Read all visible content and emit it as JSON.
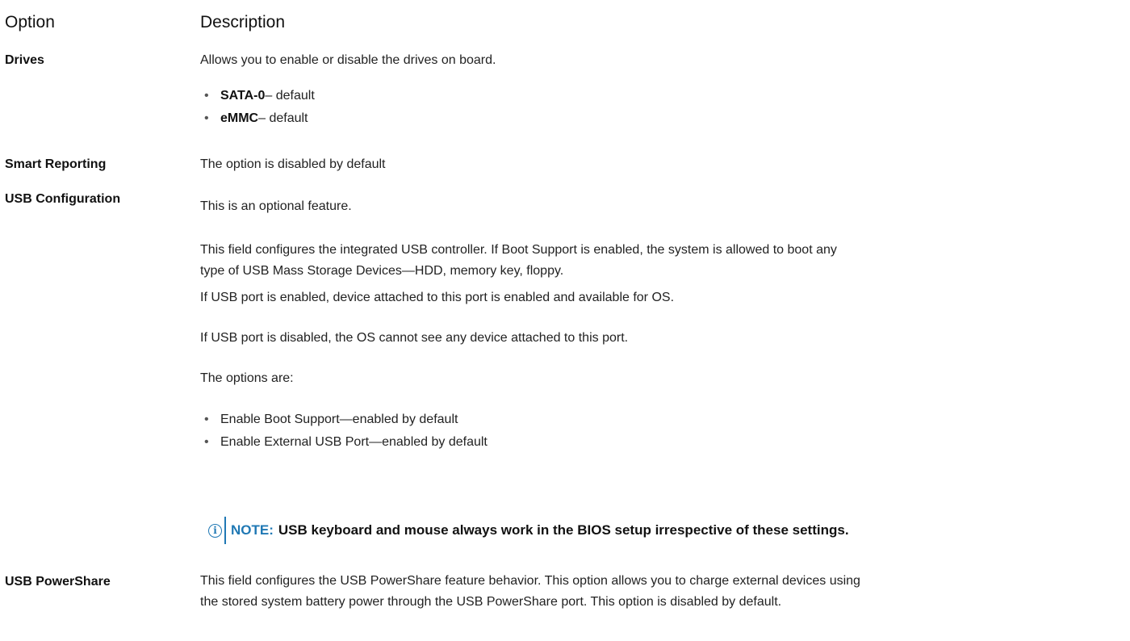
{
  "header": {
    "option": "Option",
    "description": "Description"
  },
  "drives": {
    "label": "Drives",
    "description": "Allows you to enable or disable the drives on board.",
    "items": [
      {
        "bold": "SATA-0",
        "rest": "– default"
      },
      {
        "bold": "eMMC",
        "rest": "– default"
      }
    ]
  },
  "smart_reporting": {
    "label": "Smart Reporting",
    "description": "The option is disabled by default"
  },
  "usb_configuration": {
    "label": "USB Configuration",
    "p1": "This is an optional feature.",
    "p2_line1": "This field configures the integrated USB controller. If Boot Support is enabled, the system is allowed to boot any",
    "p2_line2": "type of USB Mass Storage Devices—HDD, memory key, floppy.",
    "p3": "If USB port is enabled, device attached to this port is enabled and available for OS.",
    "p4": "If USB port is disabled, the OS cannot see any device attached to this port.",
    "p5": "The options are:",
    "options": [
      "Enable Boot Support—enabled by default",
      "Enable External USB Port—enabled by default"
    ],
    "note_icon": "info-icon",
    "note_label": "NOTE:",
    "note_text": "USB keyboard and mouse always work in the BIOS setup irrespective of these settings."
  },
  "usb_powershare": {
    "label": "USB PowerShare",
    "line1": "This field configures the USB PowerShare feature behavior. This option allows you to charge external devices using",
    "line2": "the stored system battery power through the USB PowerShare port. This option is disabled by default."
  },
  "colors": {
    "note_accent": "#1f78b4",
    "text": "#222222"
  }
}
